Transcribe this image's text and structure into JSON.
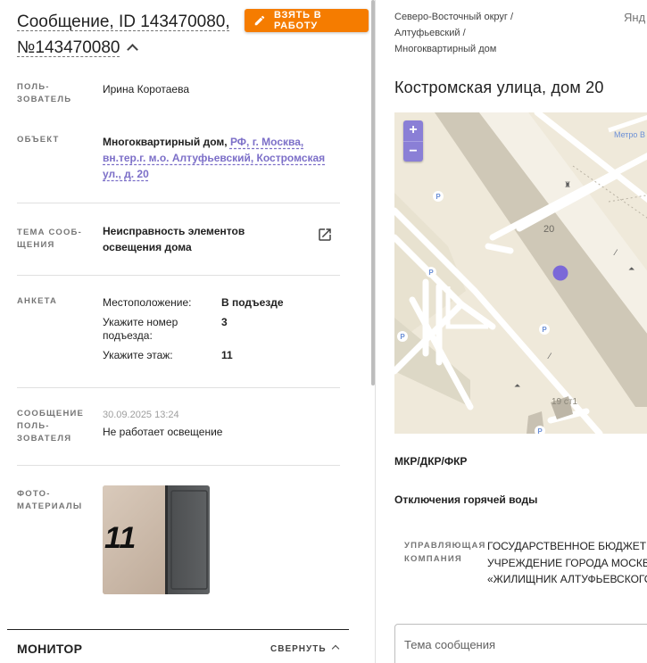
{
  "header": {
    "title": "Сообщение, ID 143470080, №143470080",
    "take_button": "ВЗЯТЬ В РАБОТУ"
  },
  "details": {
    "user_label": "ПОЛЬ-\nЗОВАТЕЛЬ",
    "user_value": "Ирина Коротаева",
    "object_label": "ОБЪЕКТ",
    "object_prefix": "Многоквартирный дом,",
    "object_link": "РФ, г. Москва, вн.тер.г. м.о. Алтуфьевский, Костромская ул., д. 20",
    "topic_label": "ТЕМА СООБ-\nЩЕНИЯ",
    "topic_value": "Неисправность элементов освещения дома",
    "anketa_label": "АНКЕТА",
    "anketa": [
      {
        "q": "Местоположение:",
        "a": "В подъезде"
      },
      {
        "q": "Укажите номер подъезда:",
        "a": "3"
      },
      {
        "q": "Укажите этаж:",
        "a": "11"
      }
    ],
    "message_label": "СООБЩЕНИЕ\nПОЛЬ-\nЗОВАТЕЛЯ",
    "message_date": "30.09.2025 13:24",
    "message_text": "Не работает освещение",
    "photo_label": "ФОТО-\nМАТЕРИАЛЫ",
    "photo_caption": "11"
  },
  "monitor": {
    "title": "МОНИТОР",
    "collapse_label": "СВЕРНУТЬ"
  },
  "right": {
    "breadcrumb": [
      "Северо-Восточный округ /",
      "Алтуфьевский /",
      "Многоквартирный дом"
    ],
    "yandex": "Янд",
    "address": "Костромская улица, дом 20",
    "map": {
      "zoom_in": "+",
      "zoom_out": "−",
      "metro_label": "Метро В",
      "house_label": "20",
      "building_label": "19 ст1",
      "parking": "P"
    },
    "mkr": "МКР/ДКР/ФКР",
    "hot_water": "Отключения горячей воды",
    "mgmt_label": "УПРАВЛЯЮЩАЯ\nКОМПАНИЯ",
    "mgmt_value": [
      "ГОСУДАРСТВЕННОЕ БЮДЖЕТН",
      "УЧРЕЖДЕНИЕ ГОРОДА МОСКВ",
      "«ЖИЛИЩНИК АЛТУФЬЕВСКОГО"
    ],
    "input_placeholder": "Тема сообщения"
  },
  "colors": {
    "accent_orange": "#f57c00",
    "link_purple": "#7c6fc8",
    "map_marker": "#7b68d8"
  }
}
